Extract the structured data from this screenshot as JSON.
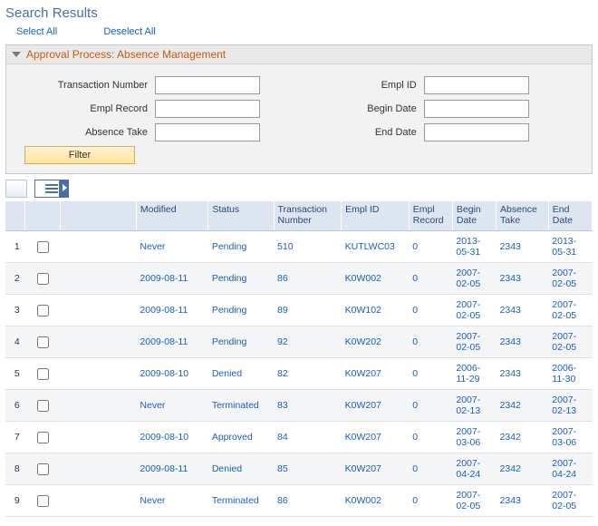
{
  "page_title": "Search Results",
  "actions": {
    "select_all": "Select All",
    "deselect_all": "Deselect All"
  },
  "section_title": "Approval Process: Absence Management",
  "filters": {
    "transaction_number_label": "Transaction Number",
    "empl_id_label": "Empl ID",
    "empl_record_label": "Empl Record",
    "begin_date_label": "Begin Date",
    "absence_take_label": "Absence Take",
    "end_date_label": "End Date",
    "filter_button": "Filter"
  },
  "columns": {
    "modified": "Modified",
    "status": "Status",
    "transaction_number": "Transaction Number",
    "empl_id": "Empl ID",
    "empl_record": "Empl Record",
    "begin_date": "Begin Date",
    "absence_take": "Absence Take",
    "end_date": "End Date"
  },
  "rows": [
    {
      "n": "1",
      "modified": "Never",
      "status": "Pending",
      "trn": "510",
      "empl": "KUTLWC03",
      "rec": "0",
      "begin": "2013-05-31",
      "take": "2343",
      "end": "2013-05-31"
    },
    {
      "n": "2",
      "modified": "2009-08-11",
      "status": "Pending",
      "trn": "86",
      "empl": "K0W002",
      "rec": "0",
      "begin": "2007-02-05",
      "take": "2343",
      "end": "2007-02-05"
    },
    {
      "n": "3",
      "modified": "2009-08-11",
      "status": "Pending",
      "trn": "89",
      "empl": "K0W102",
      "rec": "0",
      "begin": "2007-02-05",
      "take": "2343",
      "end": "2007-02-05"
    },
    {
      "n": "4",
      "modified": "2009-08-11",
      "status": "Pending",
      "trn": "92",
      "empl": "K0W202",
      "rec": "0",
      "begin": "2007-02-05",
      "take": "2343",
      "end": "2007-02-05"
    },
    {
      "n": "5",
      "modified": "2009-08-10",
      "status": "Denied",
      "trn": "82",
      "empl": "K0W207",
      "rec": "0",
      "begin": "2006-11-29",
      "take": "2343",
      "end": "2006-11-30"
    },
    {
      "n": "6",
      "modified": "Never",
      "status": "Terminated",
      "trn": "83",
      "empl": "K0W207",
      "rec": "0",
      "begin": "2007-02-13",
      "take": "2342",
      "end": "2007-02-13"
    },
    {
      "n": "7",
      "modified": "2009-08-10",
      "status": "Approved",
      "trn": "84",
      "empl": "K0W207",
      "rec": "0",
      "begin": "2007-03-06",
      "take": "2342",
      "end": "2007-03-06"
    },
    {
      "n": "8",
      "modified": "2009-08-11",
      "status": "Denied",
      "trn": "85",
      "empl": "K0W207",
      "rec": "0",
      "begin": "2007-04-24",
      "take": "2342",
      "end": "2007-04-24"
    },
    {
      "n": "9",
      "modified": "Never",
      "status": "Terminated",
      "trn": "86",
      "empl": "K0W002",
      "rec": "0",
      "begin": "2007-02-05",
      "take": "2343",
      "end": "2007-02-05"
    }
  ]
}
